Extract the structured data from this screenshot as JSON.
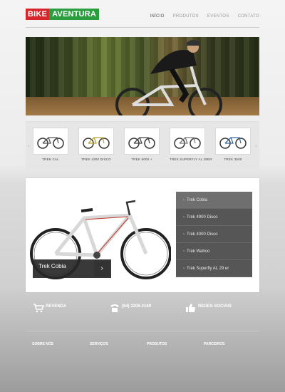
{
  "header": {
    "logo_part1": "BIKE",
    "logo_part2": "AVENTURA",
    "nav": [
      "INÍCIO",
      "PRODUTOS",
      "EVENTOS",
      "CONTATO"
    ]
  },
  "carousel": {
    "items": [
      "TREK CAL",
      "TREK 4300 DISCO",
      "TREK 6000 +",
      "TREK SUPERFLY AL 29ER",
      "TREK 3500"
    ]
  },
  "feature": {
    "models": [
      "Trek Cobia",
      "Trek 4900 Disco",
      "Trek 4000 Disco",
      "Trek Wahoo",
      "Trek Superfly AL 29 er"
    ],
    "active_index": 0,
    "caption_title": "Trek Cobia"
  },
  "contacts": [
    {
      "icon": "cart-icon",
      "title": "REVENDA",
      "detail": ""
    },
    {
      "icon": "phone-icon",
      "title": "(84) 3206-2189",
      "detail": ""
    },
    {
      "icon": "thumbs-up-icon",
      "title": "REDES SOCIAIS",
      "detail": ""
    }
  ],
  "footer": {
    "columns": [
      {
        "title": "SOBRE NÓS",
        "items": []
      },
      {
        "title": "SERVIÇOS",
        "items": []
      },
      {
        "title": "PRODUTOS",
        "items": []
      },
      {
        "title": "PARCEIROS",
        "items": []
      }
    ]
  },
  "colors": {
    "brand_red": "#d6262b",
    "brand_green": "#2a9d3f"
  }
}
